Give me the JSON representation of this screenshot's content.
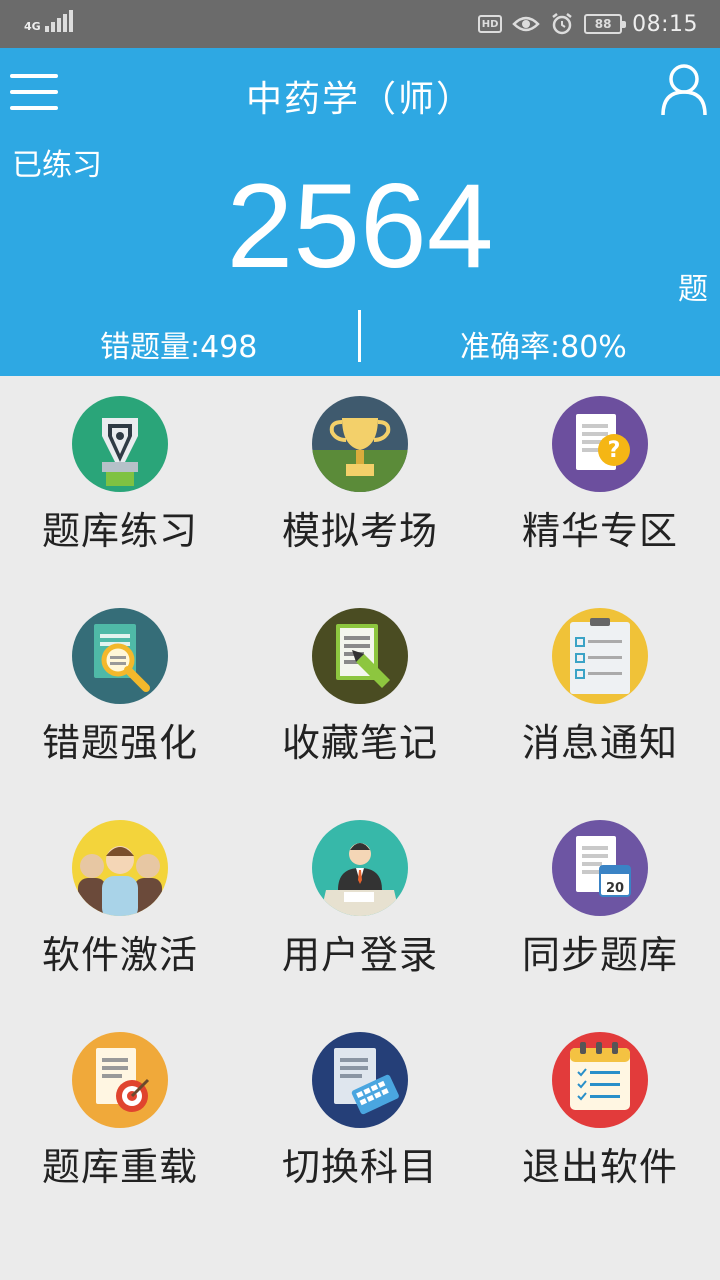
{
  "status_bar": {
    "network": "4G",
    "battery": "88",
    "time": "08:15"
  },
  "header": {
    "title": "中药学（师）",
    "practiced_label": "已练习",
    "practiced_count": "2564",
    "unit": "题",
    "wrong_count": "错题量:498",
    "accuracy": "准确率:80%"
  },
  "menu": [
    {
      "label": "题库练习",
      "icon": "pen-nib-icon"
    },
    {
      "label": "模拟考场",
      "icon": "trophy-icon"
    },
    {
      "label": "精华专区",
      "icon": "document-question-icon"
    },
    {
      "label": "错题强化",
      "icon": "document-magnifier-icon"
    },
    {
      "label": "收藏笔记",
      "icon": "document-pencil-icon"
    },
    {
      "label": "消息通知",
      "icon": "clipboard-checklist-icon"
    },
    {
      "label": "软件激活",
      "icon": "people-group-icon"
    },
    {
      "label": "用户登录",
      "icon": "user-desk-icon"
    },
    {
      "label": "同步题库",
      "icon": "document-calendar-icon"
    },
    {
      "label": "题库重载",
      "icon": "document-target-icon"
    },
    {
      "label": "切换科目",
      "icon": "document-keyboard-icon"
    },
    {
      "label": "退出软件",
      "icon": "calendar-list-icon"
    }
  ],
  "icon_calendar_day": "20"
}
